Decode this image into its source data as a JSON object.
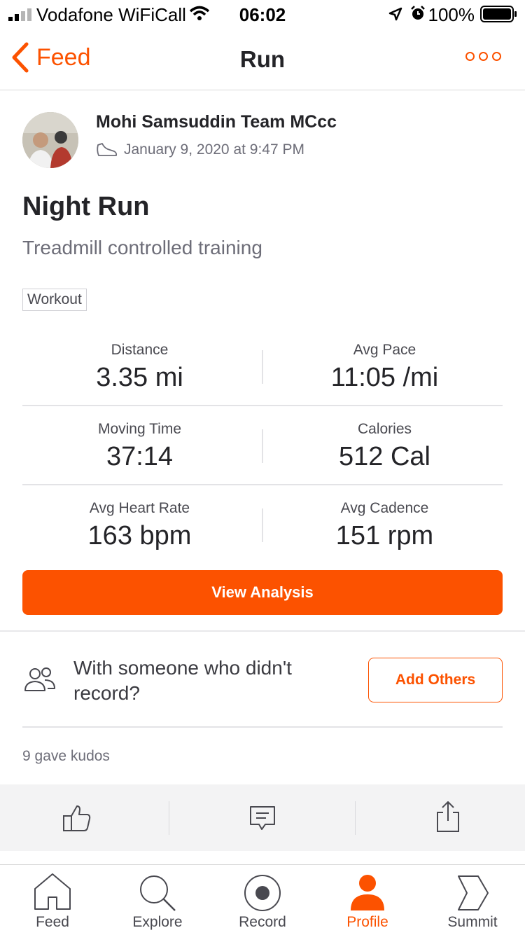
{
  "status_bar": {
    "carrier": "Vodafone WiFiCall",
    "time": "06:02",
    "battery": "100%"
  },
  "nav": {
    "back_label": "Feed",
    "title": "Run"
  },
  "activity": {
    "athlete": "Mohi Samsuddin Team MCcc",
    "date": "January 9, 2020 at 9:47 PM",
    "title": "Night Run",
    "description": "Treadmill controlled training",
    "tag": "Workout"
  },
  "stats": [
    {
      "label": "Distance",
      "value": "3.35 mi"
    },
    {
      "label": "Avg Pace",
      "value": "11:05 /mi"
    },
    {
      "label": "Moving Time",
      "value": "37:14"
    },
    {
      "label": "Calories",
      "value": "512 Cal"
    },
    {
      "label": "Avg Heart Rate",
      "value": "163 bpm"
    },
    {
      "label": "Avg Cadence",
      "value": "151 rpm"
    }
  ],
  "view_analysis": "View Analysis",
  "with_others": {
    "text": "With someone who didn't record?",
    "button": "Add Others"
  },
  "kudos": "9 gave kudos",
  "tabs": [
    {
      "label": "Feed",
      "icon": "home-icon"
    },
    {
      "label": "Explore",
      "icon": "search-icon"
    },
    {
      "label": "Record",
      "icon": "record-icon"
    },
    {
      "label": "Profile",
      "icon": "profile-icon"
    },
    {
      "label": "Summit",
      "icon": "summit-icon"
    }
  ],
  "colors": {
    "accent": "#fc5200",
    "text": "#242428",
    "muted": "#6d6d78"
  }
}
